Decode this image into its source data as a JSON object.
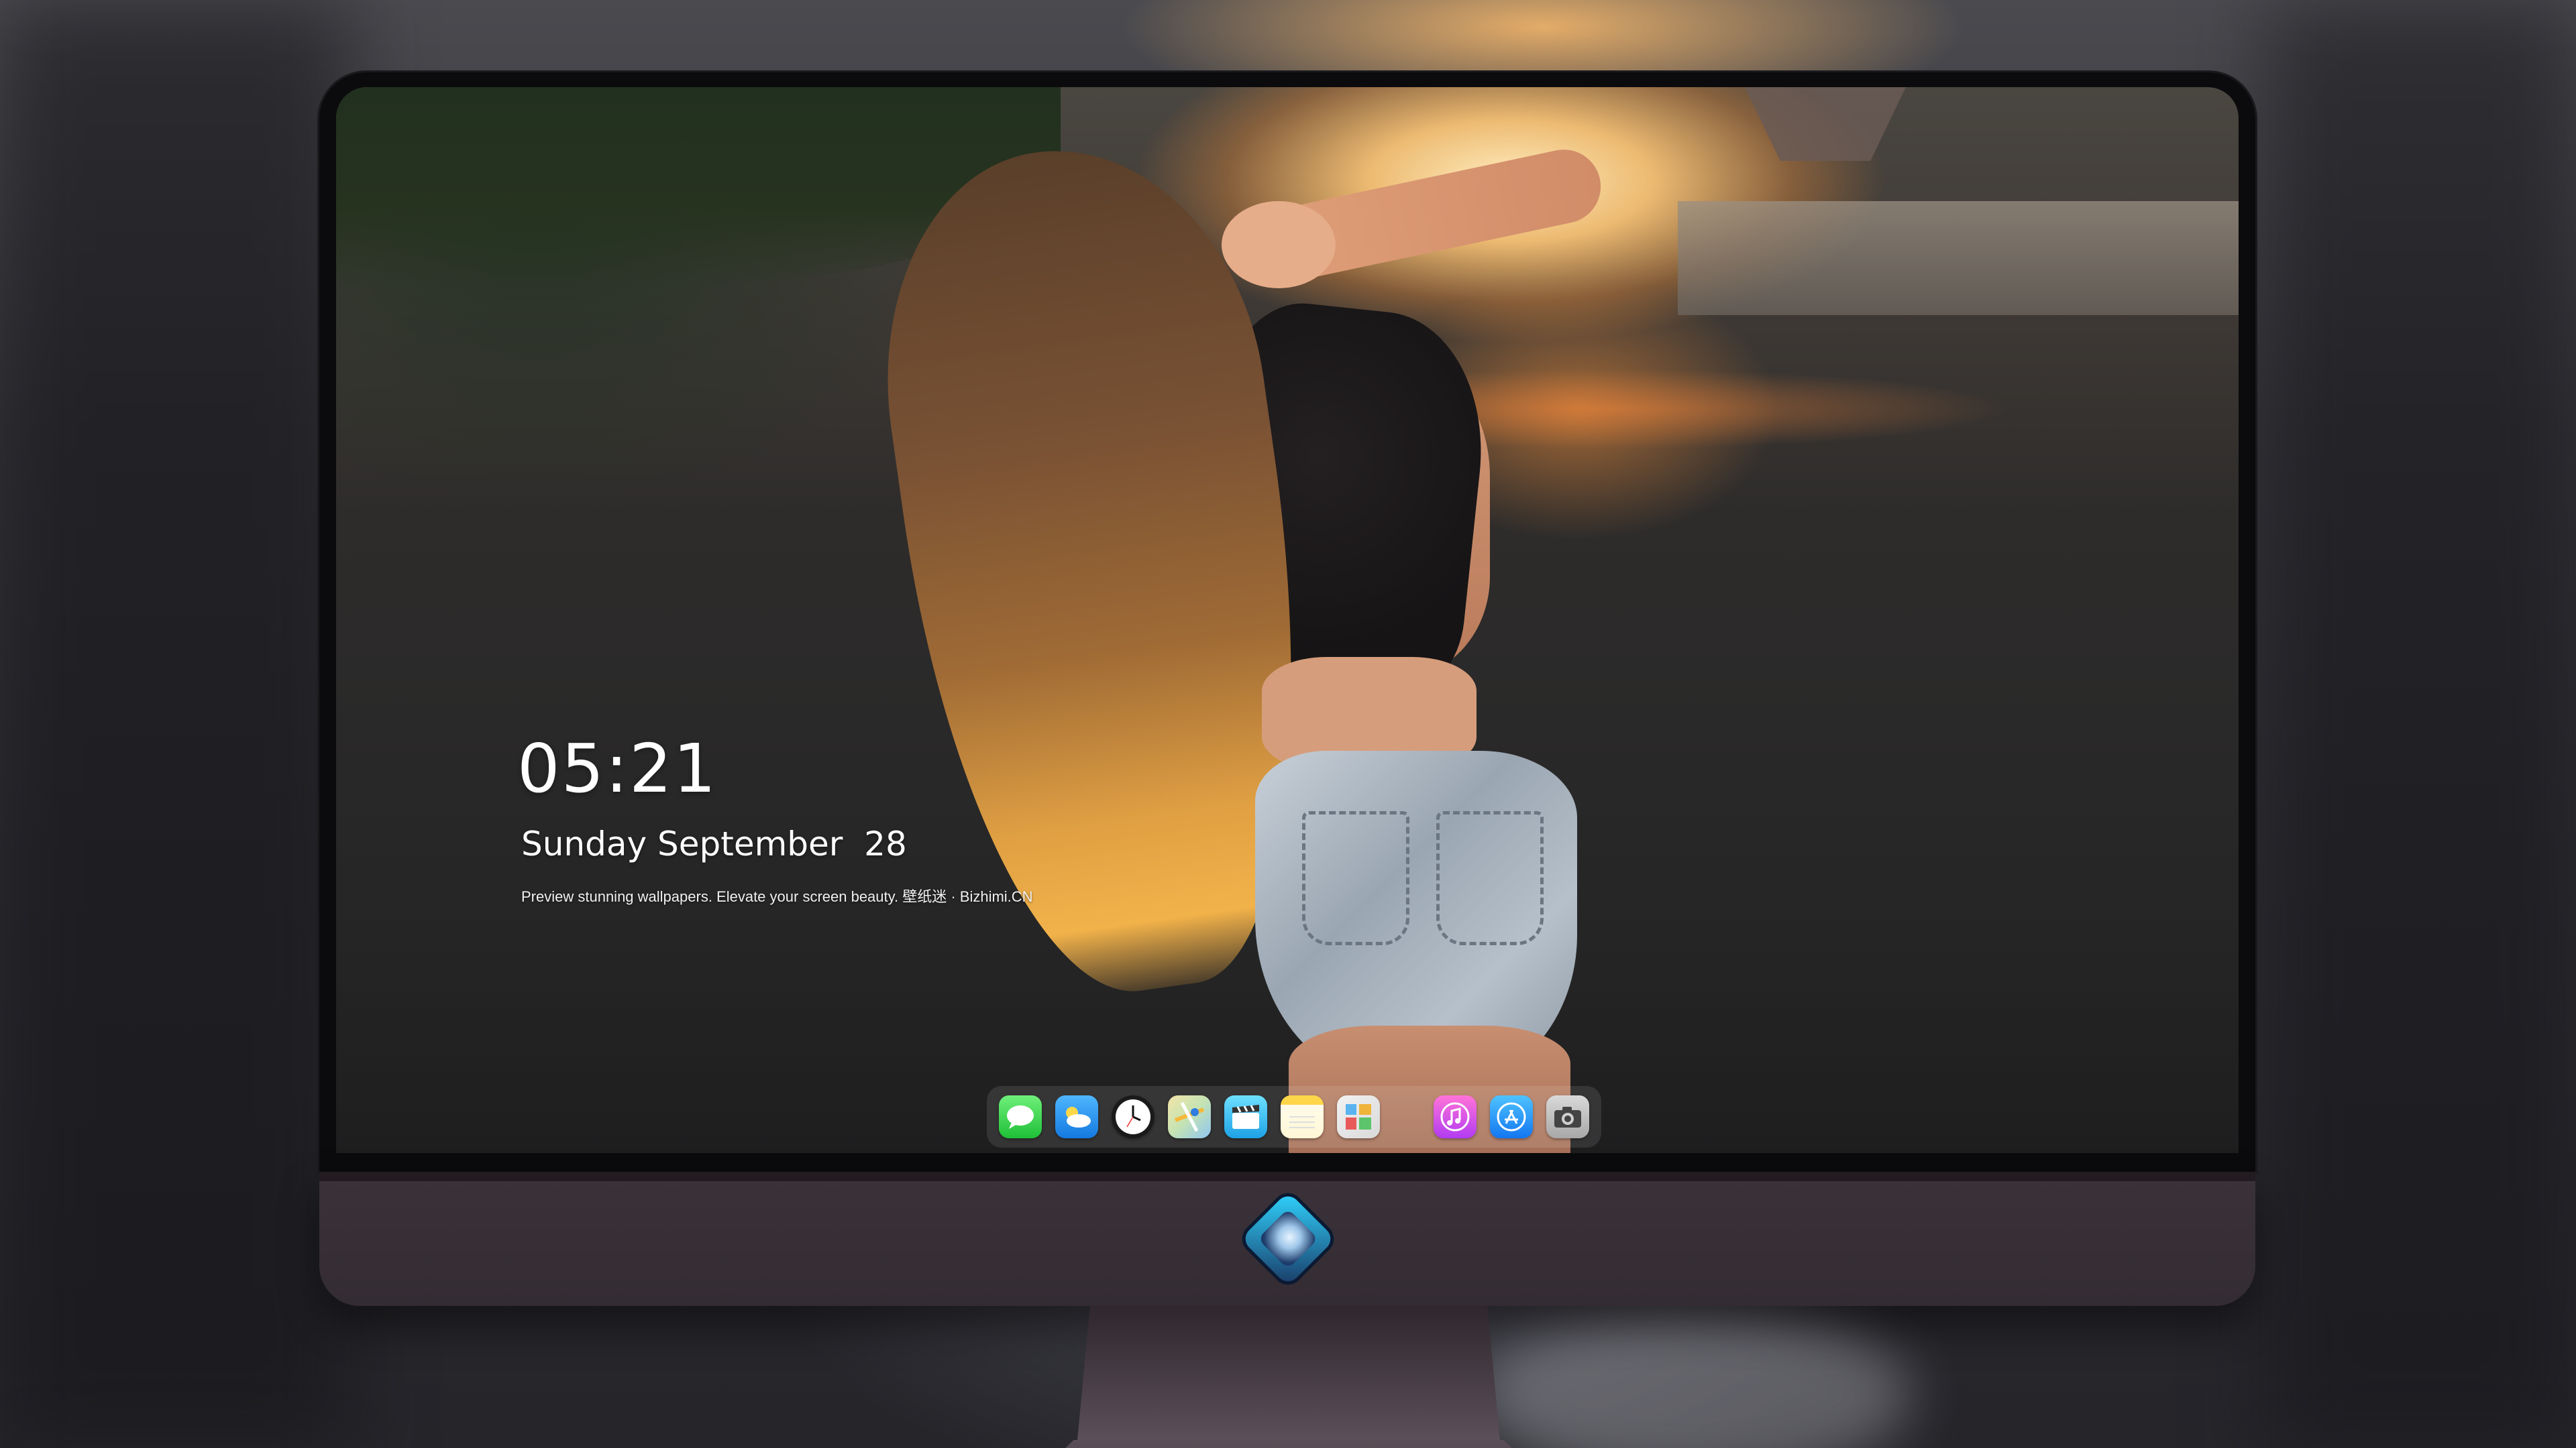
{
  "lockscreen": {
    "time": "05:21",
    "date": "Sunday September  28",
    "tagline": "Preview stunning wallpapers. Elevate your screen beauty. 壁纸迷 · Bizhimi.CN"
  },
  "dock": {
    "apps": [
      {
        "name": "Messages",
        "icon": "messages-icon"
      },
      {
        "name": "Weather",
        "icon": "weather-icon"
      },
      {
        "name": "Clock",
        "icon": "clock-icon"
      },
      {
        "name": "Maps",
        "icon": "maps-icon"
      },
      {
        "name": "Clips",
        "icon": "video-icon"
      },
      {
        "name": "Notes",
        "icon": "notes-icon"
      },
      {
        "name": "Photos",
        "icon": "photos-icon"
      },
      {
        "name": "Music",
        "icon": "music-icon"
      },
      {
        "name": "App Store",
        "icon": "app-store-icon"
      },
      {
        "name": "Camera",
        "icon": "camera-icon"
      }
    ]
  },
  "colors": {
    "bezel": "#0b0b0d",
    "chin": "#3b3239",
    "text": "#ffffff"
  }
}
